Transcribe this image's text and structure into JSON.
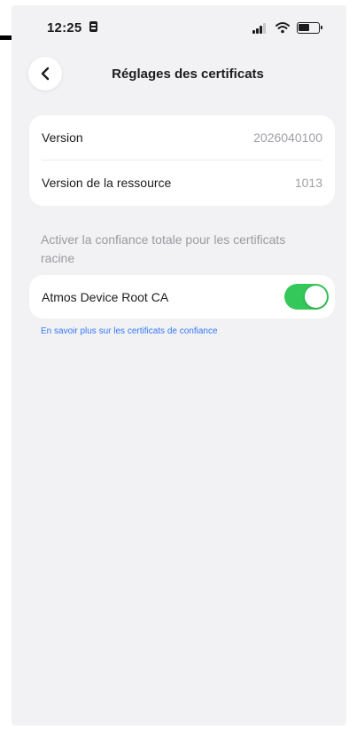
{
  "status_bar": {
    "time": "12:25",
    "icons": [
      "notification-badge-icon",
      "cellular-signal-icon",
      "wifi-icon",
      "battery-icon"
    ]
  },
  "nav": {
    "title": "Réglages des certificats",
    "back_icon": "chevron-left-icon"
  },
  "info_card": {
    "rows": [
      {
        "label": "Version",
        "value": "2026040100"
      },
      {
        "label": "Version de la ressource",
        "value": "1013"
      }
    ]
  },
  "trust_section": {
    "header": "Activer la confiance totale pour les certificats racine",
    "items": [
      {
        "label": "Atmos Device Root CA",
        "enabled": true
      }
    ],
    "learn_more_link": "En savoir plus sur les certificats de confiance"
  },
  "colors": {
    "background": "#f2f2f4",
    "card": "#ffffff",
    "toggle_on": "#34c759",
    "link": "#3478f6",
    "secondary_text": "#a0a0a6"
  }
}
